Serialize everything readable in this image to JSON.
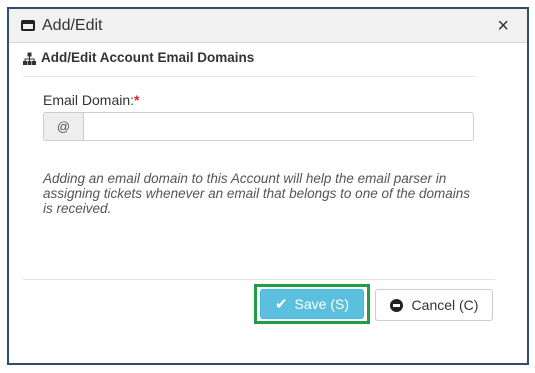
{
  "dialog": {
    "title": "Add/Edit",
    "window_icon": "window-icon",
    "close_icon": "close-icon",
    "close_glyph": "×"
  },
  "section": {
    "icon": "sitemap-icon",
    "title": "Add/Edit Account Email Domains"
  },
  "form": {
    "email_domain_label": "Email Domain:",
    "required_marker": "*",
    "addon_text": "@",
    "email_domain_value": "",
    "email_domain_placeholder": ""
  },
  "help_text": "Adding an email domain to this Account will help the email parser in assigning tickets whenever an email that belongs to one of the domains is received.",
  "footer": {
    "save_label": "Save (S)",
    "save_icon": "check-icon",
    "cancel_label": "Cancel (C)",
    "cancel_icon": "minus-circle-icon"
  },
  "colors": {
    "save_button": "#5bc0de",
    "save_highlight": "#1f9e45",
    "dialog_border": "#2f4d6e",
    "required": "#d9232d"
  }
}
